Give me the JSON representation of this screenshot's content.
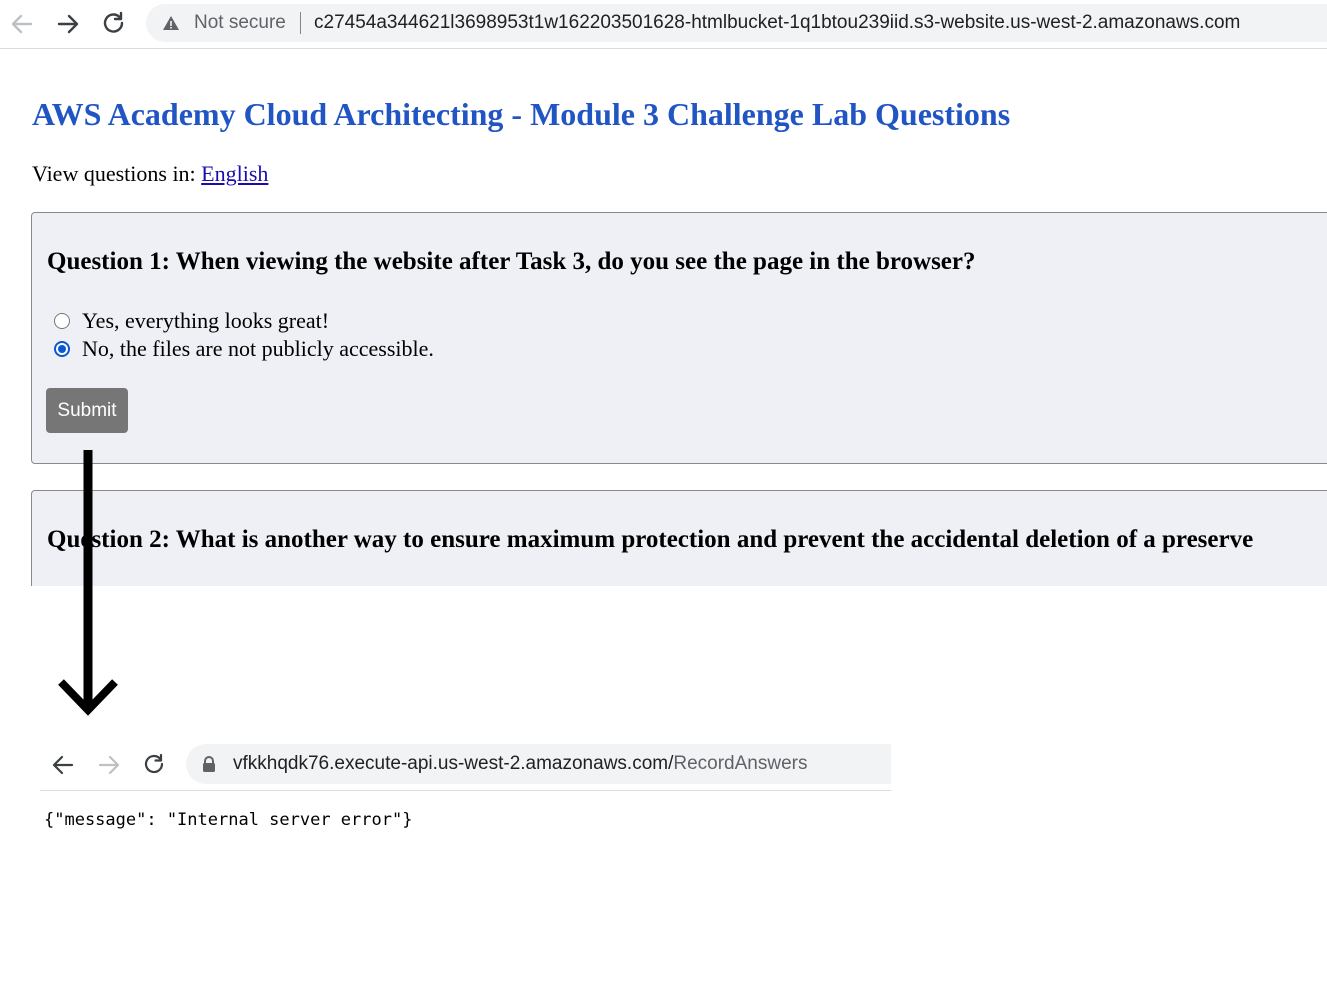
{
  "top_browser": {
    "security_label": "Not secure",
    "url": "c27454a344621l3698953t1w162203501628-htmlbucket-1q1btou239iid.s3-website.us-west-2.amazonaws.com"
  },
  "page": {
    "title": "AWS Academy Cloud Architecting - Module 3 Challenge Lab Questions",
    "view_prefix": "View questions in:",
    "language_link": "English"
  },
  "question1": {
    "heading": "Question 1: When viewing the website after Task 3, do you see the page in the browser?",
    "options": [
      {
        "label": "Yes, everything looks great!",
        "selected": false
      },
      {
        "label": "No, the files are not publicly accessible.",
        "selected": true
      }
    ],
    "submit_label": "Submit"
  },
  "question2": {
    "heading": "Question 2: What is another way to ensure maximum protection and prevent the accidental deletion of a preserve"
  },
  "second_browser": {
    "url_host": "vfkkhqdk76.execute-api.us-west-2.amazonaws.com/",
    "url_path": "RecordAnswers",
    "response": "{\"message\": \"Internal server error\"}"
  },
  "colors": {
    "title": "#2155c4",
    "card_background": "#eef0f5",
    "submit_background": "#767676",
    "radio_selected": "#0b57d0"
  },
  "icons": [
    "back-arrow-icon",
    "forward-arrow-icon",
    "reload-icon",
    "warning-icon",
    "lock-icon",
    "down-arrow-icon"
  ]
}
